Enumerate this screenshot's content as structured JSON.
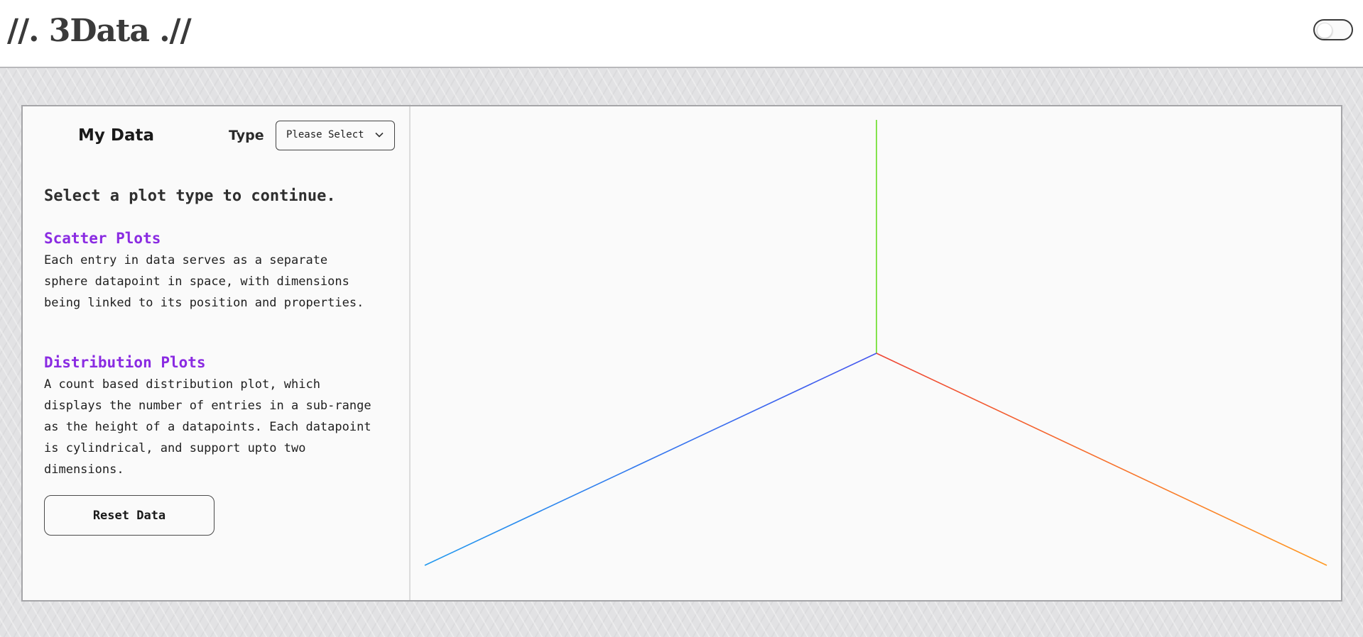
{
  "header": {
    "logo_text": "//. 3Data .//",
    "theme_toggle_state": "off"
  },
  "sidebar": {
    "title": "My Data",
    "type_label": "Type",
    "type_select": {
      "selected": "Please Select"
    },
    "instruction": "Select a plot type to continue.",
    "sections": [
      {
        "heading": "Scatter Plots",
        "body": "Each entry in data serves as a separate sphere datapoint in space, with dimensions being linked to its position and properties."
      },
      {
        "heading": "Distribution Plots",
        "body": "A count based distribution plot, which displays the number of entries in a sub-range as the height of a datapoints. Each datapoint is cylindrical, and support upto two dimensions."
      }
    ],
    "reset_label": "Reset Data"
  },
  "viewport": {
    "axes": [
      {
        "name": "y-axis",
        "color_start": "#66dd22",
        "color_end": "#88e044"
      },
      {
        "name": "x-axis",
        "color_start": "#ee4433",
        "color_end": "#ff9922"
      },
      {
        "name": "z-axis",
        "color_start": "#4455ee",
        "color_end": "#2299ee"
      }
    ]
  },
  "colors": {
    "accent": "#8a2be2",
    "background": "#e2e2e4",
    "card": "#fafafa"
  }
}
